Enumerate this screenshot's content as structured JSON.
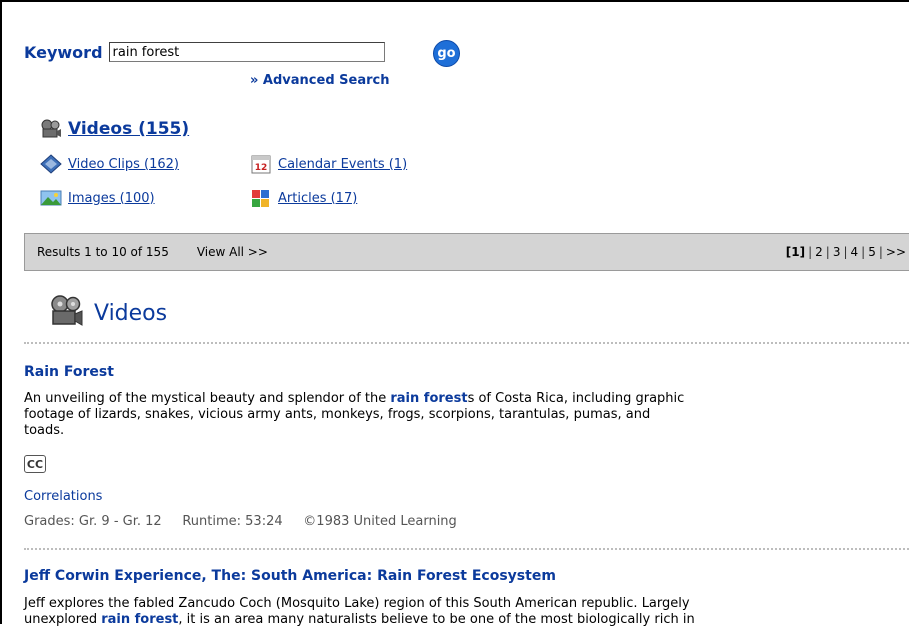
{
  "search": {
    "label": "Keyword",
    "value": "rain forest",
    "go_label": "go",
    "advanced_link": "» Advanced Search"
  },
  "categories": {
    "videos": "Videos (155)",
    "video_clips": "Video Clips (162)",
    "calendar_events": "Calendar Events (1)",
    "images": "Images (100)",
    "articles": "Articles (17)"
  },
  "results_bar": {
    "count_text": "Results 1 to 10 of 155",
    "view_all": "View All >>",
    "pages": [
      "[1]",
      "2",
      "3",
      "4",
      "5",
      ">>"
    ]
  },
  "section": {
    "title": "Videos"
  },
  "items": [
    {
      "title": "Rain Forest",
      "desc_pre": "An unveiling of the mystical beauty and splendor of the ",
      "desc_hl": "rain forest",
      "desc_post": "s of Costa Rica, including graphic",
      "desc_line2": "footage of lizards, snakes, vicious army ants, monkeys, frogs, scorpions, tarantulas, pumas, and",
      "desc_line3": "toads.",
      "cc_label": "CC",
      "correlations": "Correlations",
      "grades": "Grades: Gr. 9 - Gr. 12",
      "runtime": "Runtime: 53:24",
      "copyright": "©1983 United Learning"
    },
    {
      "title": "Jeff Corwin Experience, The: South America: Rain Forest Ecosystem",
      "desc_line1": "Jeff explores the fabled Zancudo Coch (Mosquito Lake) region of this South American republic. Largely",
      "desc2_pre": "unexplored ",
      "desc2_hl": "rain forest",
      "desc2_post": ", it is an area many naturalists believe to be one of the most biologically rich in"
    }
  ],
  "colors": {
    "link": "#0b3a9c",
    "bar": "#d4d4d4",
    "go_button": "#1e6fd8"
  },
  "icons": [
    "film-reel-icon",
    "diamond-clip-icon",
    "calendar-icon",
    "image-icon",
    "article-icon"
  ]
}
